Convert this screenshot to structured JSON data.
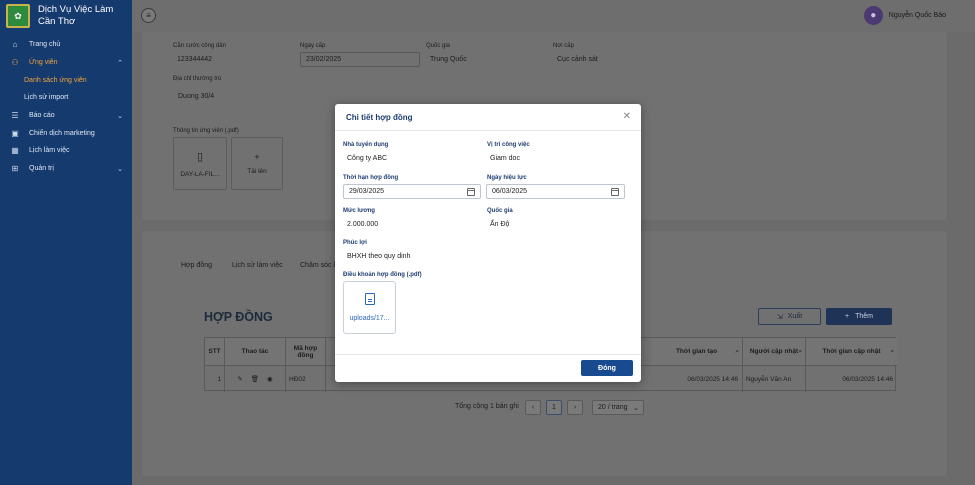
{
  "brand": {
    "name_line1": "Dịch Vụ Việc Làm",
    "name_line2": "Cần Thơ"
  },
  "sidebar": {
    "items": [
      {
        "label": "Trang chủ",
        "icon": "home-icon"
      },
      {
        "label": "Ứng viên",
        "icon": "users-icon"
      },
      {
        "label": "Danh sách ứng viên"
      },
      {
        "label": "Lịch sử import"
      },
      {
        "label": "Báo cáo",
        "icon": "list-icon"
      },
      {
        "label": "Chiến dịch marketing",
        "icon": "megaphone-icon"
      },
      {
        "label": "Lịch làm việc",
        "icon": "calendar-icon"
      },
      {
        "label": "Quản trị",
        "icon": "grid-icon"
      }
    ]
  },
  "topbar": {
    "user_name": "Nguyễn Quốc Bảo"
  },
  "profile": {
    "labels": {
      "cccd": "Căn cước công dân",
      "issue_date": "Ngày cấp",
      "nationality": "Quốc gia",
      "issue_place": "Nơi cấp",
      "address": "Địa chỉ thường trú",
      "candidate_info": "Thông tin ứng viên (.pdf)"
    },
    "values": {
      "cccd": "123344442",
      "issue_date": "23/02/2025",
      "nationality": "Trung Quốc",
      "issue_place": "Cục cảnh sát",
      "address": "Duong 30/4"
    },
    "file_name": "DAY-LA-FIL...",
    "upload_label": "Tải lên"
  },
  "tabs": [
    "Hợp đồng",
    "Lịch sử làm việc",
    "Chăm sóc k"
  ],
  "contracts": {
    "title": "HỢP ĐỒNG",
    "export_label": "Xuất",
    "add_label": "Thêm",
    "columns": [
      "STT",
      "Thao tác",
      "Mã hợp đồng",
      "Thời gian tạo",
      "Người cập nhật",
      "Thời gian cập nhật"
    ],
    "row": {
      "stt": "1",
      "code": "HĐ02",
      "created": "06/03/2025 14:46",
      "updater": "Nguyễn Văn An",
      "updated": "06/03/2025 14:46"
    }
  },
  "pagination": {
    "total": "Tổng cộng 1 bản ghi",
    "page": "1",
    "page_size": "20 / trang"
  },
  "modal": {
    "title": "Chi tiết hợp đồng",
    "employer_label": "Nhà tuyển dụng",
    "employer": "Công ty ABC",
    "position_label": "Vị trí công việc",
    "position": "Giam doc",
    "term_label": "Thời hạn hợp đồng",
    "term": "29/03/2025",
    "effective_label": "Ngày hiệu lực",
    "effective": "06/03/2025",
    "salary_label": "Mức lương",
    "salary": "2.000.000",
    "country_label": "Quốc gia",
    "country": "Ấn Độ",
    "benefits_label": "Phúc lợi",
    "benefits": "BHXH theo quy dinh",
    "terms_label": "Điều khoản hợp đồng (.pdf)",
    "file_name": "uploads/17...",
    "close_label": "Đóng"
  }
}
